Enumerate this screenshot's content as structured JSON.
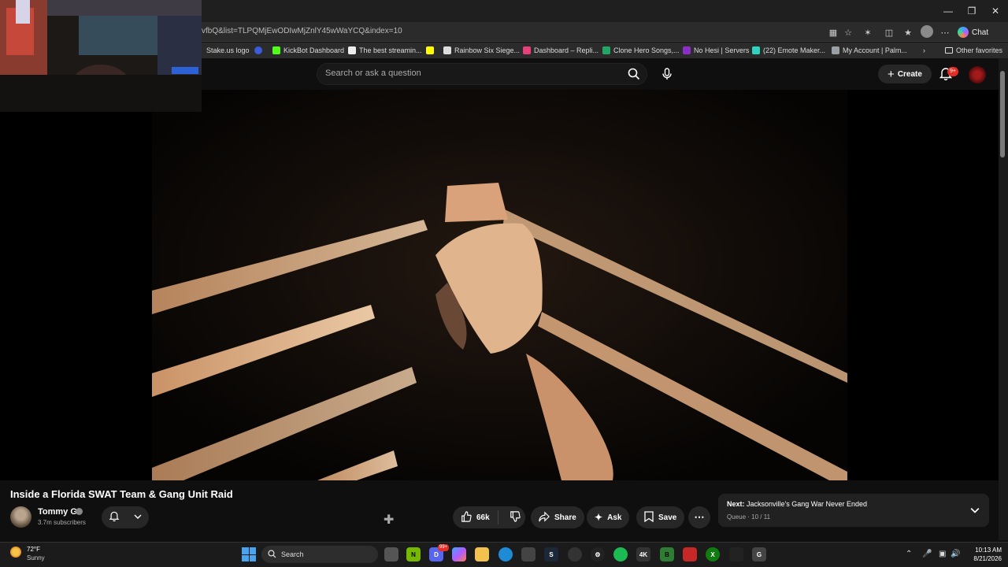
{
  "browser": {
    "url": "vfbQ&list=TLPQMjEwODIwMjZnlY45wWaYCQ&index=10",
    "chat_label": "Chat",
    "bookmarks": [
      {
        "label": "Stake.us logo",
        "color": "#2b2b2b"
      },
      {
        "label": "",
        "color": "#3b5bdb"
      },
      {
        "label": "KickBot Dashboard",
        "color": "#53fc18"
      },
      {
        "label": "The best streamin...",
        "color": "#eeeeee"
      },
      {
        "label": "",
        "color": "#fffc00"
      },
      {
        "label": "Rainbow Six Siege...",
        "color": "#dddddd"
      },
      {
        "label": "Dashboard – Repli...",
        "color": "#e8407a"
      },
      {
        "label": "Clone Hero Songs,...",
        "color": "#22a565"
      },
      {
        "label": "No Hesi | Servers",
        "color": "#8b2ec8"
      },
      {
        "label": "(22) Emote Maker...",
        "color": "#2dd4bf"
      },
      {
        "label": "My Account | Palm...",
        "color": "#9aa0a6"
      }
    ],
    "other_favorites": "Other favorites"
  },
  "youtube": {
    "search_placeholder": "Search or ask a question",
    "create_label": "Create",
    "notification_badge": "9+"
  },
  "video": {
    "title": "Inside a Florida SWAT Team & Gang Unit Raid",
    "channel": "Tommy G",
    "subscribers": "3.7m subscribers",
    "likes": "66k",
    "share_label": "Share",
    "ask_label": "Ask",
    "save_label": "Save"
  },
  "queue": {
    "next_prefix": "Next:",
    "next_title": "Jacksonville's Gang War Never Ended",
    "queue_label": "Queue",
    "position": "10 / 11"
  },
  "taskbar": {
    "temperature": "72°F",
    "weather": "Sunny",
    "search_label": "Search",
    "time": "10:13 AM",
    "date": "8/21/2026",
    "app_badge": "99+"
  },
  "colors": {
    "accent_red": "#e52d27",
    "windows_blue": "#4aa3ef"
  }
}
